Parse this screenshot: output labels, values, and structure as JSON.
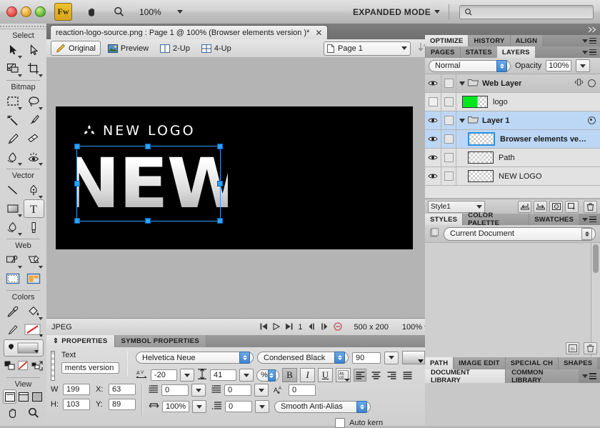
{
  "titlebar": {
    "app_badge": "Fw",
    "hand_icon": "hand-icon",
    "zoom_icon": "magnifier-icon",
    "zoom_level": "100%",
    "mode_label": "EXPANDED MODE",
    "search_placeholder": ""
  },
  "tools": {
    "sections": [
      {
        "title": "Select",
        "items": [
          {
            "name": "pointer-tool",
            "sub": true
          },
          {
            "name": "subselection-tool",
            "sub": false
          },
          {
            "name": "scale-tool",
            "sub": true
          },
          {
            "name": "crop-tool",
            "sub": true
          }
        ]
      },
      {
        "title": "Bitmap",
        "items": [
          {
            "name": "marquee-tool",
            "sub": true
          },
          {
            "name": "lasso-tool",
            "sub": true
          },
          {
            "name": "magic-wand-tool",
            "sub": false
          },
          {
            "name": "brush-tool",
            "sub": false
          },
          {
            "name": "pencil-tool",
            "sub": false
          },
          {
            "name": "eraser-tool",
            "sub": false
          },
          {
            "name": "blur-smudge-tool",
            "sub": true
          },
          {
            "name": "dodge-burn-tool",
            "sub": true
          }
        ]
      },
      {
        "title": "Vector",
        "items": [
          {
            "name": "line-tool",
            "sub": false
          },
          {
            "name": "pen-tool",
            "sub": true
          },
          {
            "name": "rectangle-tool",
            "sub": true
          },
          {
            "name": "text-tool",
            "sub": false,
            "selected": true
          },
          {
            "name": "freeform-tool",
            "sub": true
          },
          {
            "name": "knife-tool",
            "sub": false
          }
        ]
      },
      {
        "title": "Web",
        "items": [
          {
            "name": "rectangle-hotspot-tool",
            "sub": true
          },
          {
            "name": "polygon-slice-tool",
            "sub": true
          },
          {
            "name": "hide-slices-tool",
            "sub": false
          },
          {
            "name": "show-slices-tool",
            "sub": false
          }
        ]
      },
      {
        "title": "Colors",
        "items": [
          {
            "name": "eyedropper-tool",
            "sub": false
          },
          {
            "name": "paint-bucket-tool",
            "sub": true
          },
          {
            "name": "stroke-color-tool",
            "sub": false
          },
          {
            "name": "fill-color-tool",
            "sub": true
          }
        ]
      },
      {
        "title": "View",
        "items": [
          {
            "name": "standard-screen-mode",
            "sub": false,
            "selected": true
          },
          {
            "name": "full-screen-with-menus-mode",
            "sub": false
          },
          {
            "name": "full-screen-mode",
            "sub": false
          },
          {
            "name": "hand-tool",
            "sub": false
          },
          {
            "name": "zoom-tool",
            "sub": false
          }
        ]
      }
    ]
  },
  "document": {
    "tab_title": "reaction-logo-source.png : Page 1 @ 100% (Browser elements version )*",
    "close_glyph": "✕"
  },
  "viewbar": {
    "buttons": [
      {
        "label": "Original",
        "icon": "pencil-icon",
        "active": true
      },
      {
        "label": "Preview",
        "icon": "image-icon",
        "active": false
      },
      {
        "label": "2-Up",
        "icon": "two-panes-icon",
        "active": false
      },
      {
        "label": "4-Up",
        "icon": "four-panes-icon",
        "active": false
      }
    ],
    "page_selector": "Page 1",
    "sort_icon": "arrange-icon"
  },
  "canvas": {
    "logo_mark_icon": "tri-blade-icon",
    "logo_text": "NEW LOGO",
    "big_word": "NEW",
    "background": "#000000",
    "workspace_color": "#b4b4b4"
  },
  "statusbar": {
    "format": "JPEG",
    "first_icon": "first-frame-icon",
    "play_icon": "play-icon",
    "last_icon": "last-frame-icon",
    "frame_number": "1",
    "prev_icon": "prev-frame-icon",
    "next_icon": "next-frame-icon",
    "stop_icon": "stop-icon",
    "dimensions": "500 x 200",
    "zoom": "100%"
  },
  "properties": {
    "tabs": [
      {
        "label": "PROPERTIES",
        "active": true
      },
      {
        "label": "SYMBOL PROPERTIES",
        "active": false
      }
    ],
    "object_type": "Text",
    "object_name": "ments version",
    "font_family": "Helvetica Neue",
    "font_style": "Condensed Black",
    "font_size": "90",
    "kerning_icon": "kerning-icon",
    "kerning": "-20",
    "leading_icon": "leading-icon",
    "leading": "41",
    "leading_unit": "%",
    "bold_label": "B",
    "italic_label": "I",
    "underline_label": "U",
    "case_icon": "text-case-icon",
    "align_icons": [
      "align-left-icon",
      "align-center-icon",
      "align-right-icon",
      "align-justify-icon"
    ],
    "width_label": "W",
    "width": "199",
    "x_label": "X:",
    "x": "63",
    "height_label": "H:",
    "height": "103",
    "y_label": "Y:",
    "y": "89",
    "indent_icon": "paragraph-indent-icon",
    "indent": "0",
    "space_before_icon": "space-before-icon",
    "space_before": "0",
    "baseline_icon": "baseline-shift-icon",
    "baseline": "0",
    "hscale_icon": "horizontal-scale-icon",
    "hscale": "100%",
    "space_after_icon": "space-after-icon",
    "space_after": "0",
    "antialias": "Smooth Anti-Alias",
    "auto_kern_label": "Auto kern",
    "auto_kern_checked": false
  },
  "right_panel": {
    "top_tabs": [
      {
        "label": "OPTIMIZE",
        "active": true
      },
      {
        "label": "HISTORY",
        "active": false
      },
      {
        "label": "ALIGN",
        "active": false
      }
    ],
    "layer_tabs": [
      {
        "label": "PAGES",
        "active": false
      },
      {
        "label": "STATES",
        "active": false
      },
      {
        "label": "LAYERS",
        "active": true
      }
    ],
    "blend_mode": "Normal",
    "opacity_label": "Opacity",
    "opacity_value": "100%",
    "layers": [
      {
        "name": "Web Layer",
        "type": "group",
        "visible": true,
        "expanded": true,
        "selected": false,
        "marker": "circle-outline",
        "share_icon": "share-layer-icon"
      },
      {
        "name": "logo",
        "type": "item",
        "visible": false,
        "thumb": "green-slice",
        "selected": false
      },
      {
        "name": "Layer 1",
        "type": "group",
        "visible": true,
        "expanded": true,
        "selected": true,
        "marker": "radio-dot"
      },
      {
        "name": "Browser elements ve…",
        "type": "item",
        "visible": true,
        "thumb": "transparent",
        "selected": true
      },
      {
        "name": "Path",
        "type": "item",
        "visible": true,
        "thumb": "transparent",
        "selected": false
      },
      {
        "name": "NEW LOGO",
        "type": "item",
        "visible": true,
        "thumb": "transparent",
        "selected": false
      }
    ],
    "style_select": "Style1",
    "layer_buttons": [
      "new-sub-layer-icon",
      "new-layer-icon",
      "new-bitmap-image-icon",
      "duplicate-layer-icon",
      "delete-layer-icon"
    ],
    "styles_tabs": [
      {
        "label": "STYLES",
        "active": true
      },
      {
        "label": "COLOR PALETTE",
        "active": false
      },
      {
        "label": "SWATCHES",
        "active": false
      }
    ],
    "styles_source": "Current Document",
    "styles_source_icon": "document-icon",
    "styles_buttons": [
      "new-style-icon",
      "delete-style-icon"
    ],
    "bottom_tabs": [
      {
        "label": "PATH",
        "active": true
      },
      {
        "label": "IMAGE EDIT",
        "active": false
      },
      {
        "label": "SPECIAL CH",
        "active": false
      },
      {
        "label": "SHAPES",
        "active": false
      }
    ],
    "library_tabs": [
      {
        "label": "DOCUMENT LIBRARY",
        "active": true
      },
      {
        "label": "COMMON LIBRARY",
        "active": false
      }
    ]
  }
}
